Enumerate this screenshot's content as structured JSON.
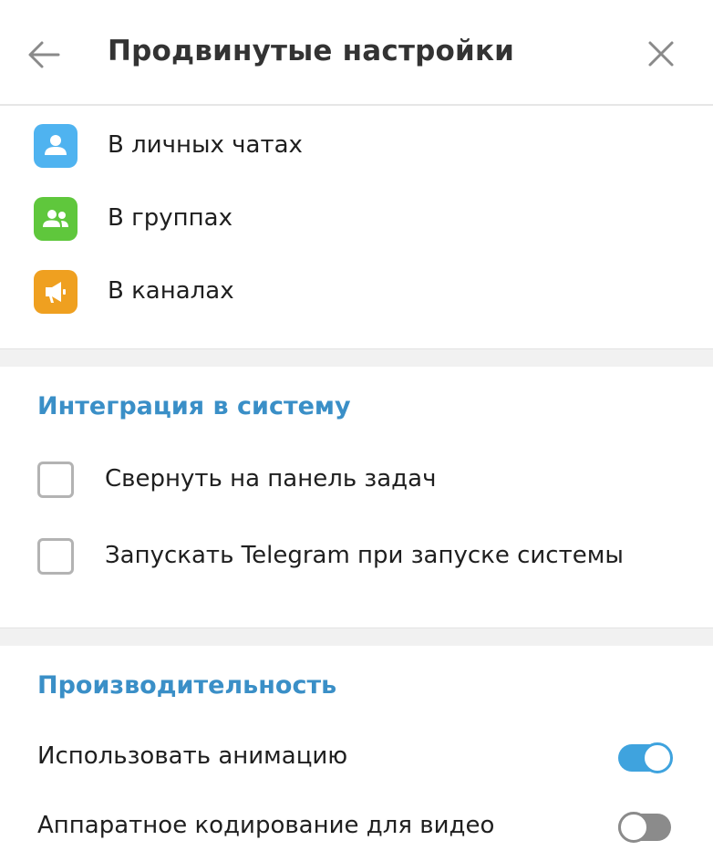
{
  "header": {
    "title": "Продвинутые настройки",
    "back_icon": "arrow-left-icon",
    "close_icon": "close-icon"
  },
  "chat_types": [
    {
      "label": "В личных чатах",
      "icon": "user-icon",
      "color": "#4fb3f0"
    },
    {
      "label": "В группах",
      "icon": "group-icon",
      "color": "#5fc73c"
    },
    {
      "label": "В каналах",
      "icon": "megaphone-icon",
      "color": "#efa020"
    }
  ],
  "integration": {
    "title": "Интеграция в систему",
    "options": [
      {
        "label": "Свернуть на панель задач",
        "checked": false
      },
      {
        "label": "Запускать Telegram при запуске системы",
        "checked": false
      }
    ]
  },
  "performance": {
    "title": "Производительность",
    "options": [
      {
        "label": "Использовать анимацию",
        "enabled": true
      },
      {
        "label": "Аппаратное кодирование для видео",
        "enabled": false
      }
    ]
  },
  "colors": {
    "accent": "#3a8fc7",
    "toggle_on": "#3fa3de",
    "toggle_off": "#8b8b8b"
  }
}
